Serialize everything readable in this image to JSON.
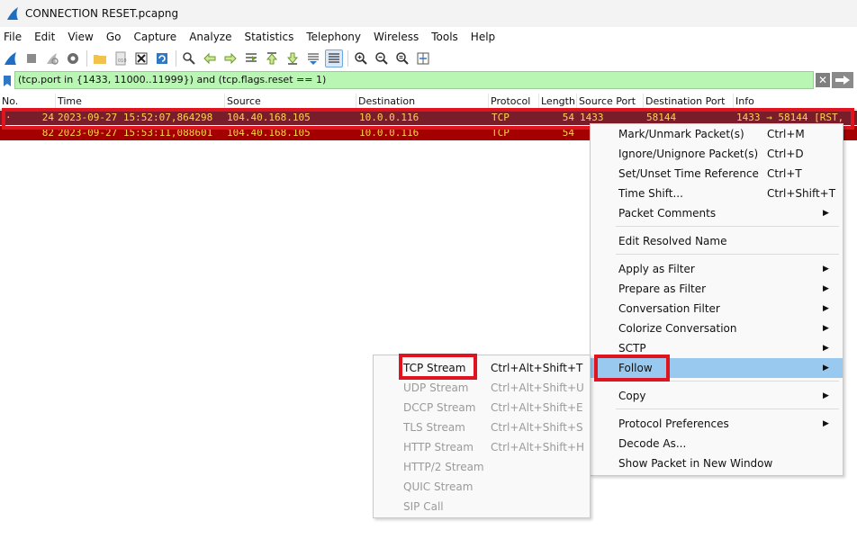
{
  "window": {
    "title": "CONNECTION RESET.pcapng"
  },
  "menubar": [
    "File",
    "Edit",
    "View",
    "Go",
    "Capture",
    "Analyze",
    "Statistics",
    "Telephony",
    "Wireless",
    "Tools",
    "Help"
  ],
  "toolbar": {
    "icons": [
      "shark-fin-start-icon",
      "stop-icon",
      "restart-icon",
      "options-gear-icon",
      "open-folder-icon",
      "save-file-icon",
      "close-file-icon",
      "reload-icon",
      "find-icon",
      "go-back-icon",
      "go-forward-icon",
      "go-to-packet-icon",
      "first-packet-icon",
      "last-packet-icon",
      "autoscroll-icon",
      "colorize-icon",
      "zoom-in-icon",
      "zoom-out-icon",
      "normal-size-icon",
      "resize-columns-icon"
    ]
  },
  "filter": {
    "value": "(tcp.port in {1433, 11000..11999}) and (tcp.flags.reset == 1)"
  },
  "columns": [
    "No.",
    "Time",
    "Source",
    "Destination",
    "Protocol",
    "Length",
    "Source Port",
    "Destination Port",
    "Info"
  ],
  "packets": [
    {
      "no": "24",
      "time": "2023-09-27 15:52:07,864298",
      "source": "104.40.168.105",
      "destination": "10.0.0.116",
      "protocol": "TCP",
      "length": "54",
      "src_port": "1433",
      "dst_port": "58144",
      "info": "1433 → 58144 [RST,"
    },
    {
      "no": "82",
      "time": "2023-09-27 15:53:11,088601",
      "source": "104.40.168.105",
      "destination": "10.0.0.116",
      "protocol": "TCP",
      "length": "54",
      "src_port": "",
      "dst_port": "",
      "info": ""
    }
  ],
  "context_menu": {
    "items": [
      {
        "label": "Mark/Unmark Packet(s)",
        "shortcut": "Ctrl+M"
      },
      {
        "label": "Ignore/Unignore Packet(s)",
        "shortcut": "Ctrl+D"
      },
      {
        "label": "Set/Unset Time Reference",
        "shortcut": "Ctrl+T"
      },
      {
        "label": "Time Shift...",
        "shortcut": "Ctrl+Shift+T"
      },
      {
        "label": "Packet Comments",
        "shortcut": ""
      },
      {
        "label": "Edit Resolved Name",
        "shortcut": ""
      },
      {
        "label": "Apply as Filter",
        "shortcut": ""
      },
      {
        "label": "Prepare as Filter",
        "shortcut": ""
      },
      {
        "label": "Conversation Filter",
        "shortcut": ""
      },
      {
        "label": "Colorize Conversation",
        "shortcut": ""
      },
      {
        "label": "SCTP",
        "shortcut": ""
      },
      {
        "label": "Follow",
        "shortcut": ""
      },
      {
        "label": "Copy",
        "shortcut": ""
      },
      {
        "label": "Protocol Preferences",
        "shortcut": ""
      },
      {
        "label": "Decode As...",
        "shortcut": ""
      },
      {
        "label": "Show Packet in New Window",
        "shortcut": ""
      }
    ]
  },
  "follow_submenu": {
    "items": [
      {
        "label": "TCP Stream",
        "shortcut": "Ctrl+Alt+Shift+T"
      },
      {
        "label": "UDP Stream",
        "shortcut": "Ctrl+Alt+Shift+U"
      },
      {
        "label": "DCCP Stream",
        "shortcut": "Ctrl+Alt+Shift+E"
      },
      {
        "label": "TLS Stream",
        "shortcut": "Ctrl+Alt+Shift+S"
      },
      {
        "label": "HTTP Stream",
        "shortcut": "Ctrl+Alt+Shift+H"
      },
      {
        "label": "HTTP/2 Stream",
        "shortcut": ""
      },
      {
        "label": "QUIC Stream",
        "shortcut": ""
      },
      {
        "label": "SIP Call",
        "shortcut": ""
      }
    ]
  },
  "colors": {
    "row_rst": "#a40000",
    "row_selected": "#7a1d2a",
    "row_text": "#ffd24d",
    "filter_valid": "#b9f5b3",
    "menu_highlight": "#99c9ef",
    "annotation_box": "#e0141e"
  }
}
